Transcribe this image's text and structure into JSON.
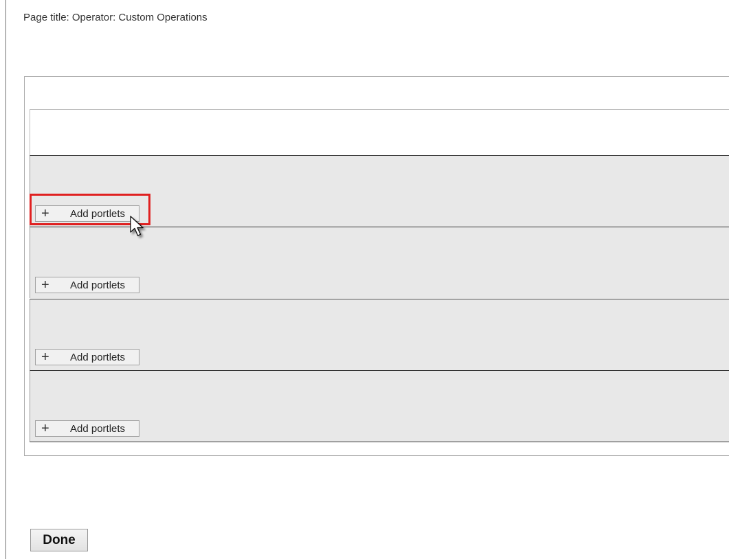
{
  "page": {
    "title": "Page title: Operator: Custom Operations"
  },
  "rows": [
    {
      "button_label": "Add portlets",
      "button_icon": "plus-icon"
    },
    {
      "button_label": "Add portlets",
      "button_icon": "plus-icon"
    },
    {
      "button_label": "Add portlets",
      "button_icon": "plus-icon"
    },
    {
      "button_label": "Add portlets",
      "button_icon": "plus-icon"
    }
  ],
  "done_label": "Done",
  "highlight": {
    "color": "#e02020",
    "target_row": 1
  },
  "colors": {
    "row_background": "#e8e8e8",
    "button_background": "#f1f1f1"
  }
}
